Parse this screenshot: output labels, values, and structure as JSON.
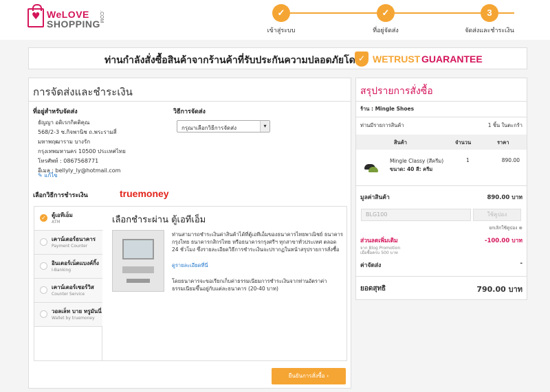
{
  "header": {
    "logo_line1": "WeLOVE",
    "logo_line2": "SHOPPING",
    "logo_domain": ".COM",
    "steps": [
      {
        "num": "✓",
        "label": "เข้าสู่ระบบ"
      },
      {
        "num": "✓",
        "label": "ที่อยู่จัดส่ง"
      },
      {
        "num": "3",
        "label": "จัดส่งและชำระเงิน"
      }
    ]
  },
  "banner": {
    "text": "ท่านกำลังสั่งซื้อสินค้าจากร้านค้าที่รับประกันความปลอดภัยโดย",
    "brand1": "WETRUST",
    "brand2": "GUARANTEE"
  },
  "left": {
    "title": "การจัดส่งและชำระเงิน",
    "address_heading": "ที่อยู่สำหรับจัดส่ง",
    "address_lines": [
      "ธัญญา อดิเรกกิตติคุณ",
      "568/2-3 ซ.กิจพานิช ถ.พระรามสี่",
      "มหาพฤฒาราม บางรัก",
      "กรุงเทพมหานคร 10500 ประเทศไทย",
      "โทรศัพท์ : 0867568771",
      "อีเมล : bellyly_ly@hotmail.com"
    ],
    "edit_label": "แก้ไข",
    "shipping_heading": "วิธีการจัดส่ง",
    "shipping_select": "กรุณาเลือกวิธีการจัดส่ง",
    "payment_heading": "เลือกวิธีการชำระเงิน",
    "truemoney": "truemoney",
    "tabs": [
      {
        "title": "ตู้เอทีเอ็ม",
        "sub": "ATM",
        "active": true
      },
      {
        "title": "เคาน์เตอร์ธนาคาร",
        "sub": "Payment Counter",
        "active": false
      },
      {
        "title": "อินเตอร์เน็ตแบงค์กิ้ง",
        "sub": "I-Banking",
        "active": false
      },
      {
        "title": "เคาน์เตอร์เซอร์วิส",
        "sub": "Counter Service",
        "active": false
      },
      {
        "title": "วอลเล็ท บาย ทรูมันนี่",
        "sub": "Wallet by truemoney",
        "active": false
      }
    ],
    "pay_title": "เลือกชำระผ่าน ตู้เอทีเอ็ม",
    "pay_desc": "ท่านสามารถชำระเงินค่าสินค้าได้ที่ตู้เอทีเอ็มของธนาคารไทยพาณิชย์ ธนาคารกรุงไทย ธนาคารกสิกรไทย หรือธนาคารกรุงศรีฯ ทุกสาขาทั่วประเทศ ตลอด 24 ชั่วโมง ซึ่งรายละเอียดวิธีการชำระเงินจะปรากฏในหน้าสรุปรายการสั่งซื้อ",
    "pay_link": "ดูรายละเอียดที่นี่",
    "pay_note": "โดยธนาคารจะขอเรียกเก็บค่าธรรมเนียมการชำระเงินจากท่านอัตราค่าธรรมเนียมขึ้นอยู่กับแต่ละธนาคาร (20-40 บาท)",
    "confirm_label": "ยืนยันการสั่งซื้อ"
  },
  "right": {
    "title": "สรุปรายการสั่งซื้อ",
    "shop_label": "ร้าน : Mingle Shoes",
    "items_label": "ท่านมีรายการสินค้า",
    "items_count": "1 ชิ้น ในตะกร้า",
    "col_product": "สินค้า",
    "col_qty": "จำนวน",
    "col_price": "ราคา",
    "product_name": "Mingle Classy (สีครีม)",
    "product_size": "ขนาด: 40 สี: ครีม",
    "product_qty": "1",
    "product_price": "890.00",
    "subtotal_label": "มูลค่าสินค้า",
    "subtotal_value": "890.00 บาท",
    "coupon_placeholder": "BLG100",
    "coupon_button": "ใช้คูปอง",
    "cancel_coupon": "ยกเลิกใช้คูปอง",
    "discount_label": "ส่วนลดเพิ่มเติม",
    "discount_value": "-100.00 บาท",
    "discount_note1": "จาก Blog Promotion",
    "discount_note2": "เมื่อซื้อครบ 500 บาท",
    "shipping_label": "ค่าจัดส่ง",
    "shipping_value": "-",
    "total_label": "ยอดสุทธิ",
    "total_value": "790.00 บาท"
  },
  "colors": {
    "accent": "#f5a533",
    "brand": "#d4145a",
    "link": "#1a73c9"
  }
}
